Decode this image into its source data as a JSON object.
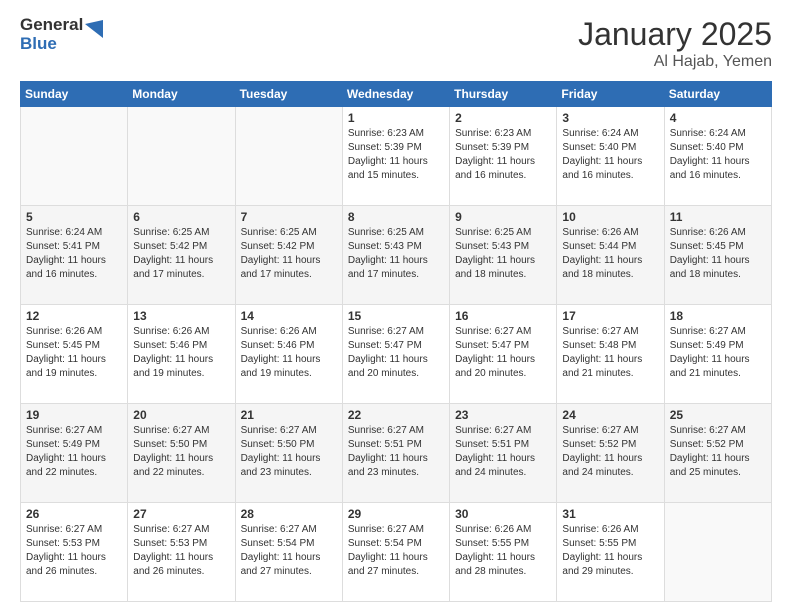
{
  "header": {
    "logo": {
      "general": "General",
      "blue": "Blue"
    },
    "title": "January 2025",
    "location": "Al Hajab, Yemen"
  },
  "calendar": {
    "days_of_week": [
      "Sunday",
      "Monday",
      "Tuesday",
      "Wednesday",
      "Thursday",
      "Friday",
      "Saturday"
    ],
    "weeks": [
      [
        {
          "day": "",
          "sunrise": "",
          "sunset": "",
          "daylight": ""
        },
        {
          "day": "",
          "sunrise": "",
          "sunset": "",
          "daylight": ""
        },
        {
          "day": "",
          "sunrise": "",
          "sunset": "",
          "daylight": ""
        },
        {
          "day": "1",
          "sunrise": "Sunrise: 6:23 AM",
          "sunset": "Sunset: 5:39 PM",
          "daylight": "Daylight: 11 hours and 15 minutes."
        },
        {
          "day": "2",
          "sunrise": "Sunrise: 6:23 AM",
          "sunset": "Sunset: 5:39 PM",
          "daylight": "Daylight: 11 hours and 16 minutes."
        },
        {
          "day": "3",
          "sunrise": "Sunrise: 6:24 AM",
          "sunset": "Sunset: 5:40 PM",
          "daylight": "Daylight: 11 hours and 16 minutes."
        },
        {
          "day": "4",
          "sunrise": "Sunrise: 6:24 AM",
          "sunset": "Sunset: 5:40 PM",
          "daylight": "Daylight: 11 hours and 16 minutes."
        }
      ],
      [
        {
          "day": "5",
          "sunrise": "Sunrise: 6:24 AM",
          "sunset": "Sunset: 5:41 PM",
          "daylight": "Daylight: 11 hours and 16 minutes."
        },
        {
          "day": "6",
          "sunrise": "Sunrise: 6:25 AM",
          "sunset": "Sunset: 5:42 PM",
          "daylight": "Daylight: 11 hours and 17 minutes."
        },
        {
          "day": "7",
          "sunrise": "Sunrise: 6:25 AM",
          "sunset": "Sunset: 5:42 PM",
          "daylight": "Daylight: 11 hours and 17 minutes."
        },
        {
          "day": "8",
          "sunrise": "Sunrise: 6:25 AM",
          "sunset": "Sunset: 5:43 PM",
          "daylight": "Daylight: 11 hours and 17 minutes."
        },
        {
          "day": "9",
          "sunrise": "Sunrise: 6:25 AM",
          "sunset": "Sunset: 5:43 PM",
          "daylight": "Daylight: 11 hours and 18 minutes."
        },
        {
          "day": "10",
          "sunrise": "Sunrise: 6:26 AM",
          "sunset": "Sunset: 5:44 PM",
          "daylight": "Daylight: 11 hours and 18 minutes."
        },
        {
          "day": "11",
          "sunrise": "Sunrise: 6:26 AM",
          "sunset": "Sunset: 5:45 PM",
          "daylight": "Daylight: 11 hours and 18 minutes."
        }
      ],
      [
        {
          "day": "12",
          "sunrise": "Sunrise: 6:26 AM",
          "sunset": "Sunset: 5:45 PM",
          "daylight": "Daylight: 11 hours and 19 minutes."
        },
        {
          "day": "13",
          "sunrise": "Sunrise: 6:26 AM",
          "sunset": "Sunset: 5:46 PM",
          "daylight": "Daylight: 11 hours and 19 minutes."
        },
        {
          "day": "14",
          "sunrise": "Sunrise: 6:26 AM",
          "sunset": "Sunset: 5:46 PM",
          "daylight": "Daylight: 11 hours and 19 minutes."
        },
        {
          "day": "15",
          "sunrise": "Sunrise: 6:27 AM",
          "sunset": "Sunset: 5:47 PM",
          "daylight": "Daylight: 11 hours and 20 minutes."
        },
        {
          "day": "16",
          "sunrise": "Sunrise: 6:27 AM",
          "sunset": "Sunset: 5:47 PM",
          "daylight": "Daylight: 11 hours and 20 minutes."
        },
        {
          "day": "17",
          "sunrise": "Sunrise: 6:27 AM",
          "sunset": "Sunset: 5:48 PM",
          "daylight": "Daylight: 11 hours and 21 minutes."
        },
        {
          "day": "18",
          "sunrise": "Sunrise: 6:27 AM",
          "sunset": "Sunset: 5:49 PM",
          "daylight": "Daylight: 11 hours and 21 minutes."
        }
      ],
      [
        {
          "day": "19",
          "sunrise": "Sunrise: 6:27 AM",
          "sunset": "Sunset: 5:49 PM",
          "daylight": "Daylight: 11 hours and 22 minutes."
        },
        {
          "day": "20",
          "sunrise": "Sunrise: 6:27 AM",
          "sunset": "Sunset: 5:50 PM",
          "daylight": "Daylight: 11 hours and 22 minutes."
        },
        {
          "day": "21",
          "sunrise": "Sunrise: 6:27 AM",
          "sunset": "Sunset: 5:50 PM",
          "daylight": "Daylight: 11 hours and 23 minutes."
        },
        {
          "day": "22",
          "sunrise": "Sunrise: 6:27 AM",
          "sunset": "Sunset: 5:51 PM",
          "daylight": "Daylight: 11 hours and 23 minutes."
        },
        {
          "day": "23",
          "sunrise": "Sunrise: 6:27 AM",
          "sunset": "Sunset: 5:51 PM",
          "daylight": "Daylight: 11 hours and 24 minutes."
        },
        {
          "day": "24",
          "sunrise": "Sunrise: 6:27 AM",
          "sunset": "Sunset: 5:52 PM",
          "daylight": "Daylight: 11 hours and 24 minutes."
        },
        {
          "day": "25",
          "sunrise": "Sunrise: 6:27 AM",
          "sunset": "Sunset: 5:52 PM",
          "daylight": "Daylight: 11 hours and 25 minutes."
        }
      ],
      [
        {
          "day": "26",
          "sunrise": "Sunrise: 6:27 AM",
          "sunset": "Sunset: 5:53 PM",
          "daylight": "Daylight: 11 hours and 26 minutes."
        },
        {
          "day": "27",
          "sunrise": "Sunrise: 6:27 AM",
          "sunset": "Sunset: 5:53 PM",
          "daylight": "Daylight: 11 hours and 26 minutes."
        },
        {
          "day": "28",
          "sunrise": "Sunrise: 6:27 AM",
          "sunset": "Sunset: 5:54 PM",
          "daylight": "Daylight: 11 hours and 27 minutes."
        },
        {
          "day": "29",
          "sunrise": "Sunrise: 6:27 AM",
          "sunset": "Sunset: 5:54 PM",
          "daylight": "Daylight: 11 hours and 27 minutes."
        },
        {
          "day": "30",
          "sunrise": "Sunrise: 6:26 AM",
          "sunset": "Sunset: 5:55 PM",
          "daylight": "Daylight: 11 hours and 28 minutes."
        },
        {
          "day": "31",
          "sunrise": "Sunrise: 6:26 AM",
          "sunset": "Sunset: 5:55 PM",
          "daylight": "Daylight: 11 hours and 29 minutes."
        },
        {
          "day": "",
          "sunrise": "",
          "sunset": "",
          "daylight": ""
        }
      ]
    ]
  }
}
